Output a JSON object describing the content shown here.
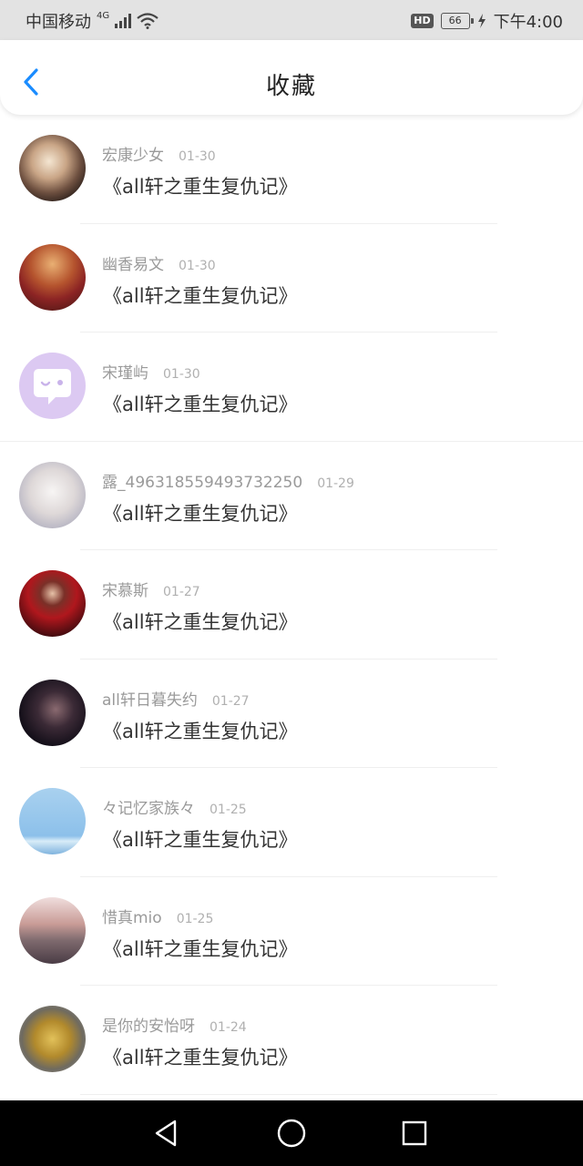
{
  "status_bar": {
    "carrier": "中国移动",
    "network": "4G",
    "hd": "HD",
    "battery": "66",
    "time": "下午4:00"
  },
  "header": {
    "title": "收藏"
  },
  "items": [
    {
      "name": "宏康少女",
      "date": "01-30",
      "book": "《all轩之重生复仇记》"
    },
    {
      "name": "幽香易文",
      "date": "01-30",
      "book": "《all轩之重生复仇记》"
    },
    {
      "name": "宋瑾屿",
      "date": "01-30",
      "book": "《all轩之重生复仇记》"
    },
    {
      "name": "露_496318559493732250",
      "date": "01-29",
      "book": "《all轩之重生复仇记》"
    },
    {
      "name": "宋慕斯",
      "date": "01-27",
      "book": "《all轩之重生复仇记》"
    },
    {
      "name": "all轩日暮失约",
      "date": "01-27",
      "book": "《all轩之重生复仇记》"
    },
    {
      "name": "々记忆家族々",
      "date": "01-25",
      "book": "《all轩之重生复仇记》"
    },
    {
      "name": "惜真mio",
      "date": "01-25",
      "book": "《all轩之重生复仇记》"
    },
    {
      "name": "是你的安怡呀",
      "date": "01-24",
      "book": "《all轩之重生复仇记》"
    }
  ],
  "colors": {
    "accent": "#1a8cff",
    "navbar": "#000000"
  }
}
